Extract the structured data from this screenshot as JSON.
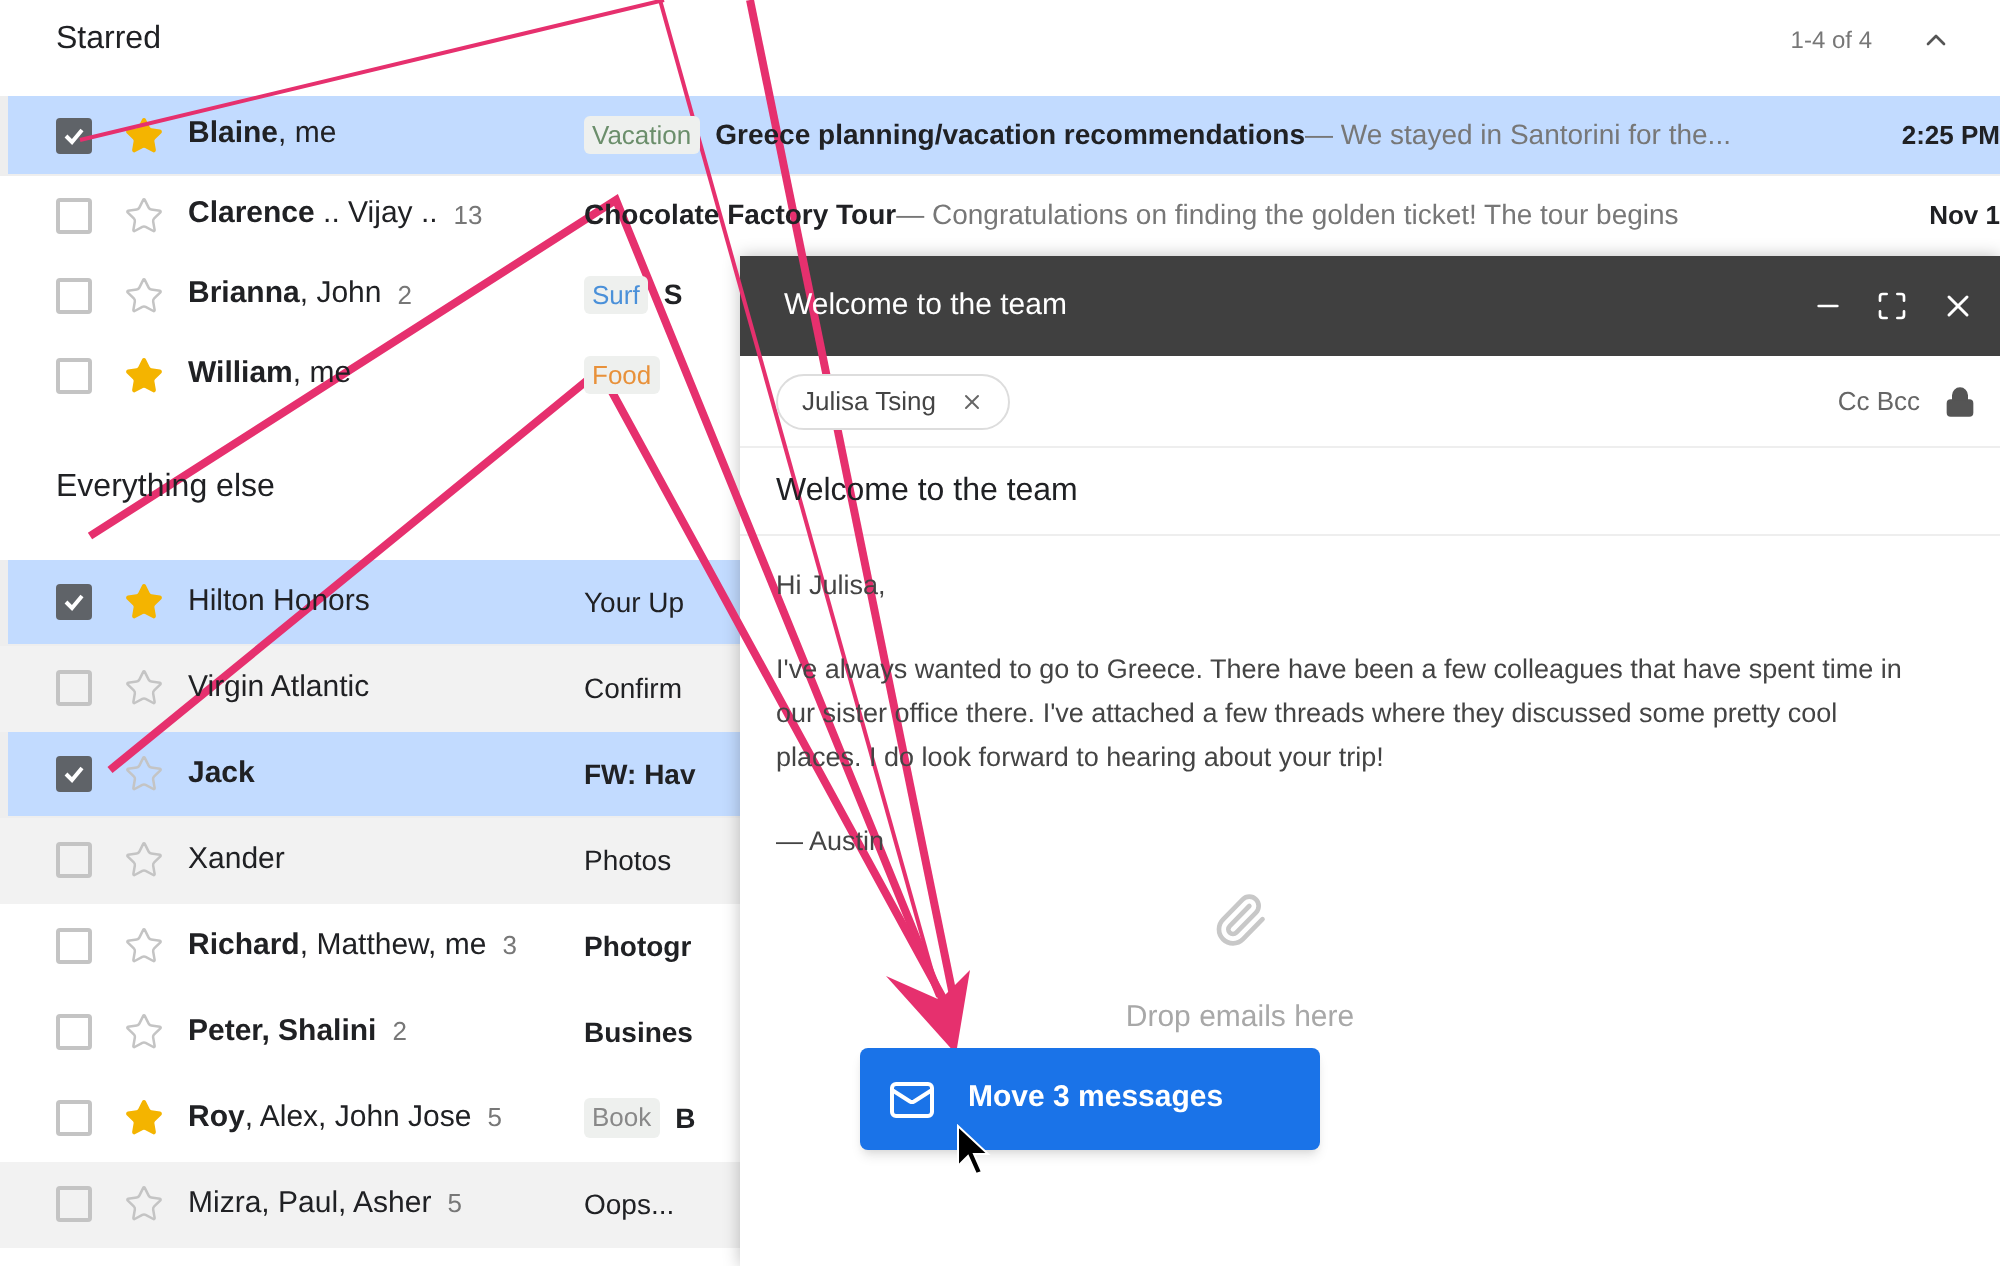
{
  "starred": {
    "title": "Starred",
    "range": "1-4 of 4",
    "expanded": true,
    "rows": [
      {
        "sender": "**Blaine**, me",
        "count": "",
        "label": {
          "text": "Vacation",
          "color": "#6b8e6b"
        },
        "subject": "Greece planning/vacation recommendations",
        "snippet": " — We stayed in Santorini for the...",
        "time": "2:25 PM",
        "selected": true,
        "starred": true,
        "read": false
      },
      {
        "sender": "**Clarence** .. Vijay ..",
        "count": "13",
        "subject": "Chocolate Factory Tour",
        "snippet": " — Congratulations on finding the golden ticket! The tour begins",
        "time": "Nov 1",
        "selected": false,
        "starred": false,
        "read": false
      },
      {
        "sender": "**Brianna**, John",
        "count": "2",
        "label": {
          "text": "Surf",
          "color": "#4a90d9"
        },
        "subject": "S",
        "snippet": "",
        "time": "",
        "selected": false,
        "starred": false,
        "read": false
      },
      {
        "sender": "**William**, me",
        "count": "",
        "label": {
          "text": "Food",
          "color": "#e8913a"
        },
        "subject": "",
        "snippet": "",
        "time": "",
        "selected": false,
        "starred": true,
        "read": false
      }
    ]
  },
  "everything_else": {
    "title": "Everything else",
    "rows": [
      {
        "sender": "Hilton Honors",
        "count": "",
        "subject": "Your Up",
        "selected": true,
        "starred": true,
        "read": true
      },
      {
        "sender": "Virgin Atlantic",
        "count": "",
        "subject": "Confirm",
        "selected": false,
        "starred": false,
        "read": true
      },
      {
        "sender": "**Jack**",
        "count": "",
        "subject": "FW: Hav",
        "selected": true,
        "starred": false,
        "read": false
      },
      {
        "sender": "Xander",
        "count": "",
        "subject": "Photos",
        "selected": false,
        "starred": false,
        "read": true
      },
      {
        "sender": "**Richard**, Matthew, me",
        "count": "3",
        "subject": "Photogr",
        "selected": false,
        "starred": false,
        "read": false
      },
      {
        "sender": "**Peter, Shalini**",
        "count": "2",
        "subject": "Busines",
        "selected": false,
        "starred": false,
        "read": false
      },
      {
        "sender": "**Roy**, Alex, John Jose",
        "count": "5",
        "label": {
          "text": "Book",
          "color": "#888888"
        },
        "subject": "B",
        "selected": false,
        "starred": true,
        "read": false
      },
      {
        "sender": "Mizra, Paul, Asher",
        "count": "5",
        "subject": "Oops...",
        "selected": false,
        "starred": false,
        "read": true
      }
    ]
  },
  "compose": {
    "title": "Welcome to the team",
    "recipients": [
      "Julisa Tsing"
    ],
    "cc_bcc": "Cc Bcc",
    "subject": "Welcome to the team",
    "body": [
      "Hi Julisa,",
      "I've always wanted to go to Greece. There have been a few colleagues that have spent time in our sister office there. I've attached a few threads where they discussed some pretty cool places. I do look forward to hearing about your trip!",
      "— Austin"
    ],
    "drop_hint": "Drop emails here"
  },
  "drag_button": {
    "label": "Move 3 messages"
  }
}
